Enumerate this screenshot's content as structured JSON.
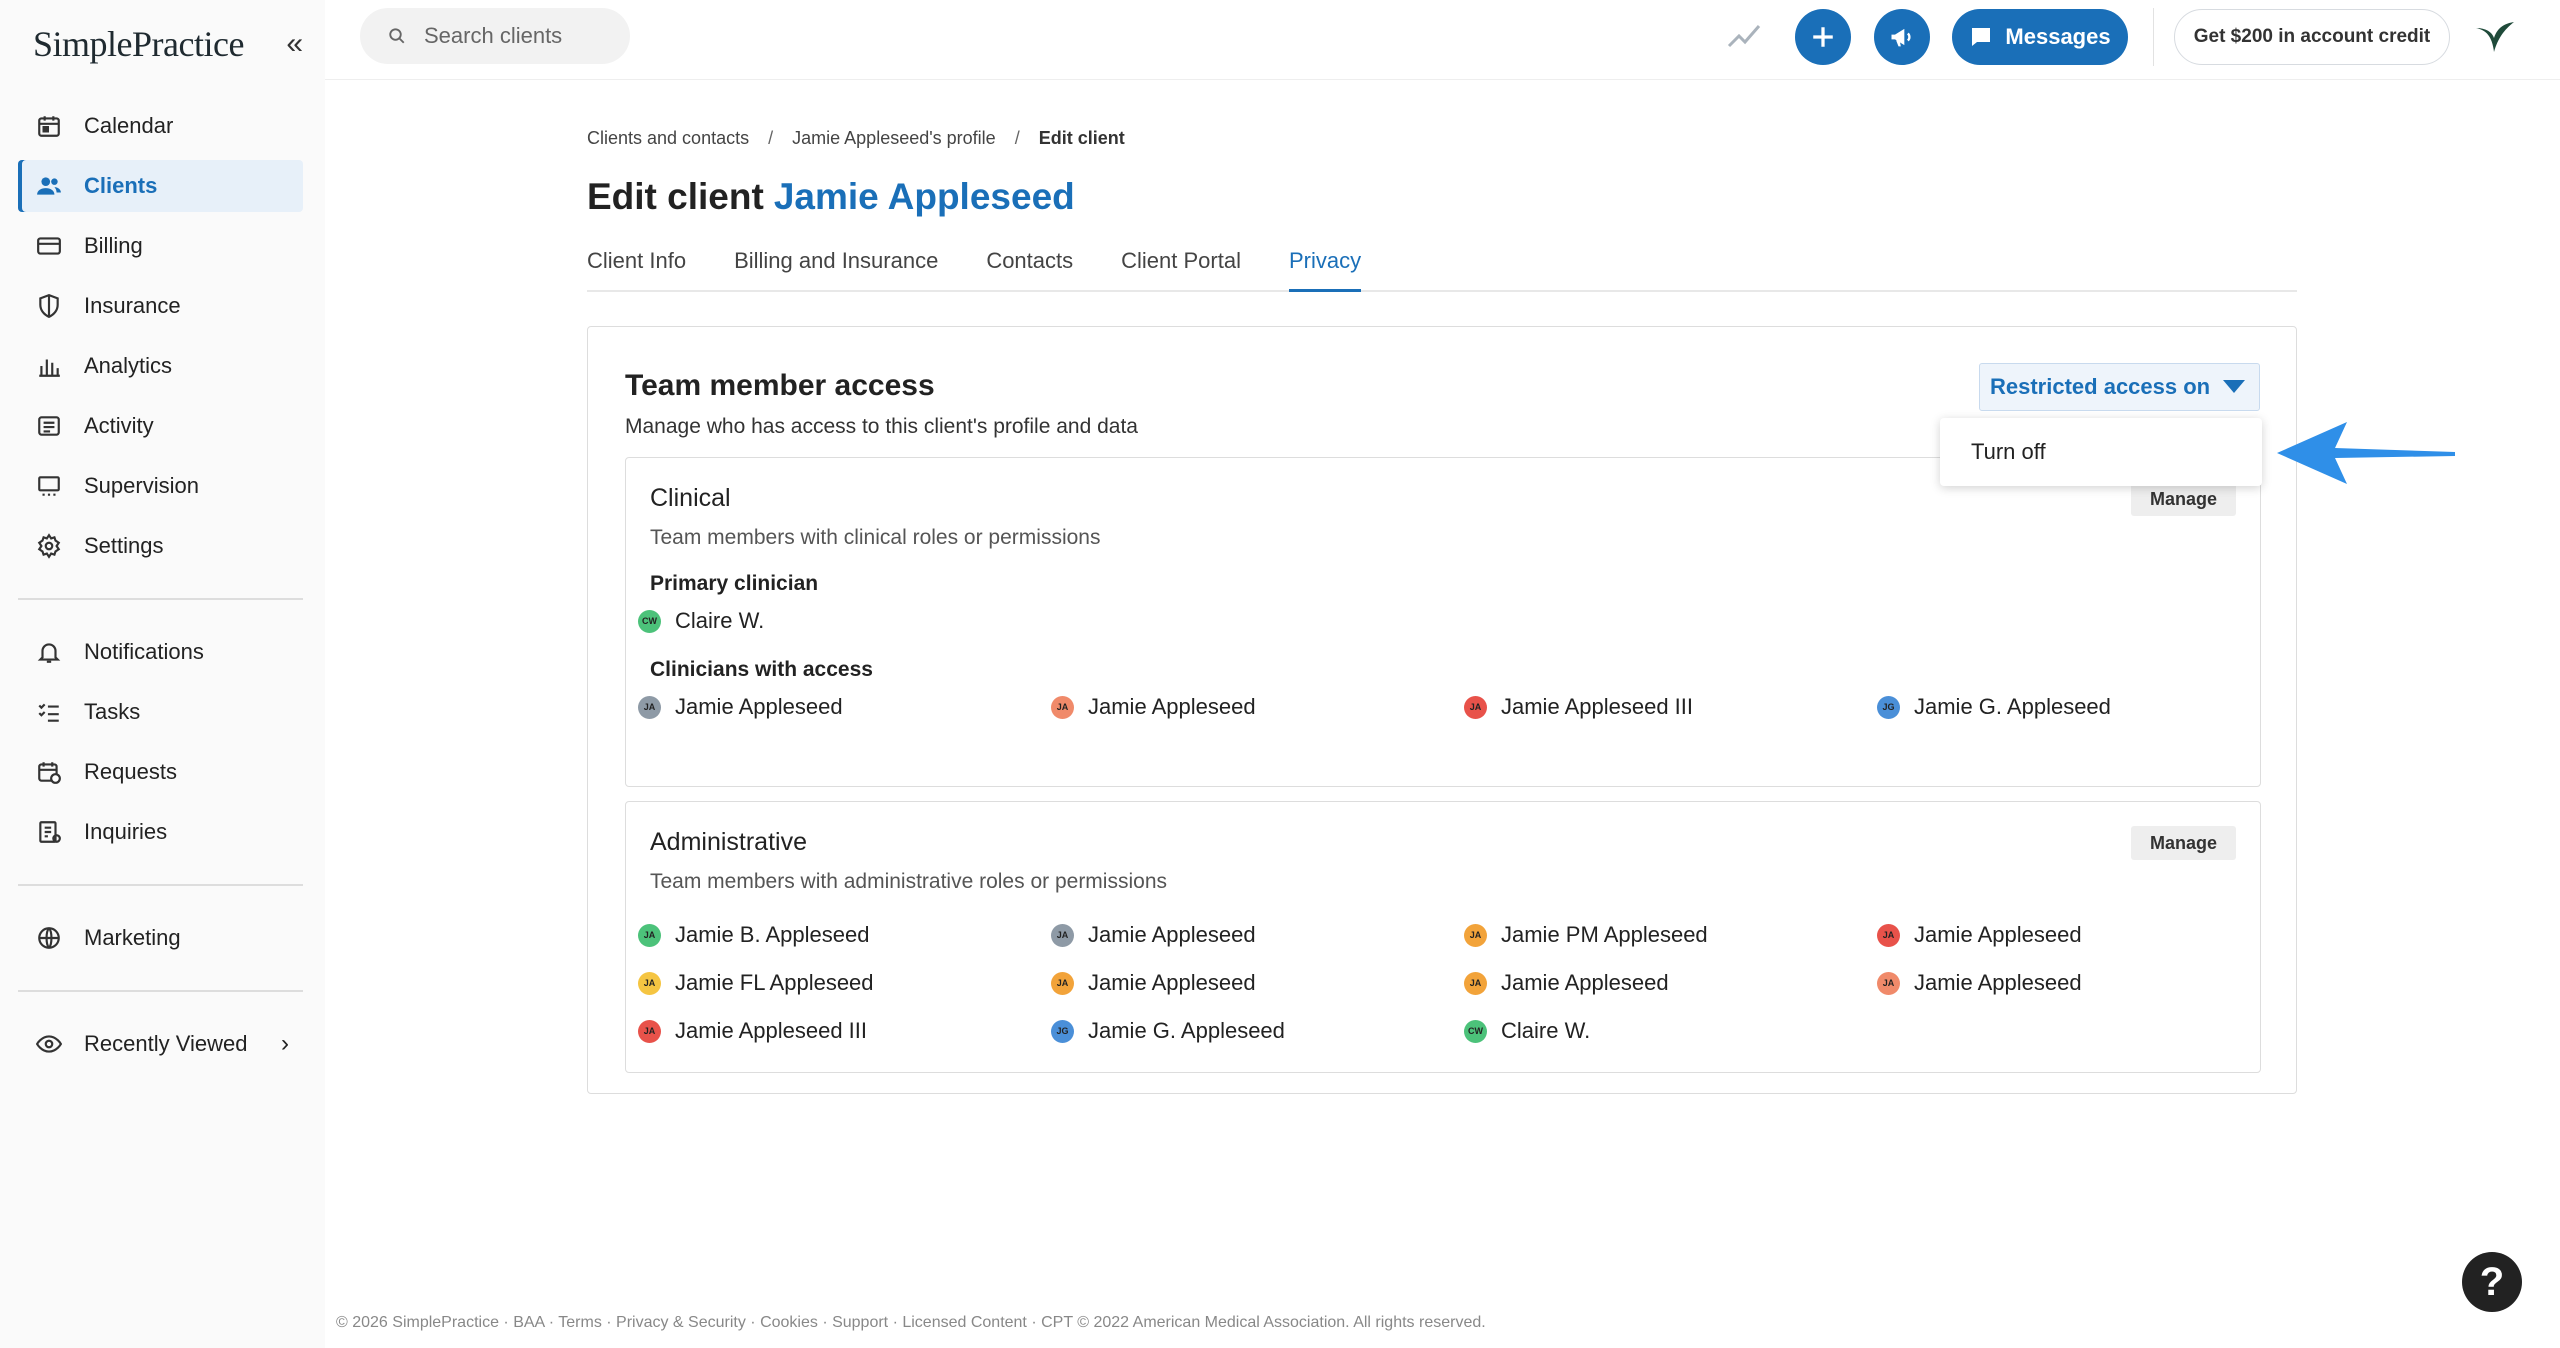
{
  "app": {
    "logo_text": "SimplePractice",
    "collapse_glyph": "«"
  },
  "sidebar": {
    "items": [
      {
        "label": "Calendar",
        "icon": "calendar-icon"
      },
      {
        "label": "Clients",
        "icon": "users-icon",
        "active": true
      },
      {
        "label": "Billing",
        "icon": "credit-card-icon"
      },
      {
        "label": "Insurance",
        "icon": "shield-icon"
      },
      {
        "label": "Analytics",
        "icon": "bar-chart-icon"
      },
      {
        "label": "Activity",
        "icon": "list-icon"
      },
      {
        "label": "Supervision",
        "icon": "supervision-icon"
      },
      {
        "label": "Settings",
        "icon": "gear-icon"
      },
      {
        "label": "Notifications",
        "icon": "bell-icon"
      },
      {
        "label": "Tasks",
        "icon": "checklist-icon"
      },
      {
        "label": "Requests",
        "icon": "calendar-request-icon"
      },
      {
        "label": "Inquiries",
        "icon": "inquiry-icon"
      },
      {
        "label": "Marketing",
        "icon": "globe-icon"
      },
      {
        "label": "Recently Viewed",
        "icon": "eye-icon"
      }
    ],
    "chevron": "›"
  },
  "topbar": {
    "search_placeholder": "Search clients",
    "messages_label": "Messages",
    "credit_label": "Get $200 in account credit",
    "accent_color": "#1a6fb8"
  },
  "breadcrumb": {
    "items": [
      "Clients and contacts",
      "Jamie Appleseed's profile",
      "Edit client"
    ],
    "separator": "/"
  },
  "page": {
    "title_prefix": "Edit client",
    "client_name": "Jamie Appleseed"
  },
  "tabs": [
    "Client Info",
    "Billing and Insurance",
    "Contacts",
    "Client Portal",
    "Privacy"
  ],
  "active_tab": "Privacy",
  "access": {
    "heading": "Team member access",
    "description": "Manage who has access to this client's profile and data",
    "status_button": "Restricted access on",
    "dropdown_option": "Turn off",
    "clinical": {
      "heading": "Clinical",
      "description": "Team members with clinical roles or permissions",
      "manage_label": "Manage",
      "primary_label": "Primary clinician",
      "primary": {
        "initials": "CW",
        "name": "Claire W.",
        "color": "#4cc27a"
      },
      "access_label": "Clinicians with access",
      "clinicians": [
        {
          "initials": "JA",
          "name": "Jamie Appleseed",
          "color": "#8e9aa6"
        },
        {
          "initials": "JA",
          "name": "Jamie Appleseed",
          "color": "#f08a6a"
        },
        {
          "initials": "JA",
          "name": "Jamie Appleseed III",
          "color": "#e8524a"
        },
        {
          "initials": "JG",
          "name": "Jamie G. Appleseed",
          "color": "#4a8fd8"
        }
      ]
    },
    "administrative": {
      "heading": "Administrative",
      "description": "Team members with administrative roles or permissions",
      "manage_label": "Manage",
      "members": [
        {
          "initials": "JA",
          "name": "Jamie B. Appleseed",
          "color": "#4cc27a"
        },
        {
          "initials": "JA",
          "name": "Jamie Appleseed",
          "color": "#8e9aa6"
        },
        {
          "initials": "JA",
          "name": "Jamie PM Appleseed",
          "color": "#f2a33a"
        },
        {
          "initials": "JA",
          "name": "Jamie Appleseed",
          "color": "#e8524a"
        },
        {
          "initials": "JA",
          "name": "Jamie FL Appleseed",
          "color": "#f5c542"
        },
        {
          "initials": "JA",
          "name": "Jamie Appleseed",
          "color": "#f2a33a"
        },
        {
          "initials": "JA",
          "name": "Jamie Appleseed",
          "color": "#f2a33a"
        },
        {
          "initials": "JA",
          "name": "Jamie Appleseed",
          "color": "#f08a6a"
        },
        {
          "initials": "JA",
          "name": "Jamie Appleseed III",
          "color": "#e8524a"
        },
        {
          "initials": "JG",
          "name": "Jamie G. Appleseed",
          "color": "#4a8fd8"
        },
        {
          "initials": "CW",
          "name": "Claire W.",
          "color": "#4cc27a"
        }
      ]
    }
  },
  "footer": {
    "text": "© 2026 SimplePractice · BAA · Terms · Privacy & Security · Cookies · Support · Licensed Content · CPT © 2022 American Medical Association. All rights reserved."
  },
  "help_label": "?"
}
